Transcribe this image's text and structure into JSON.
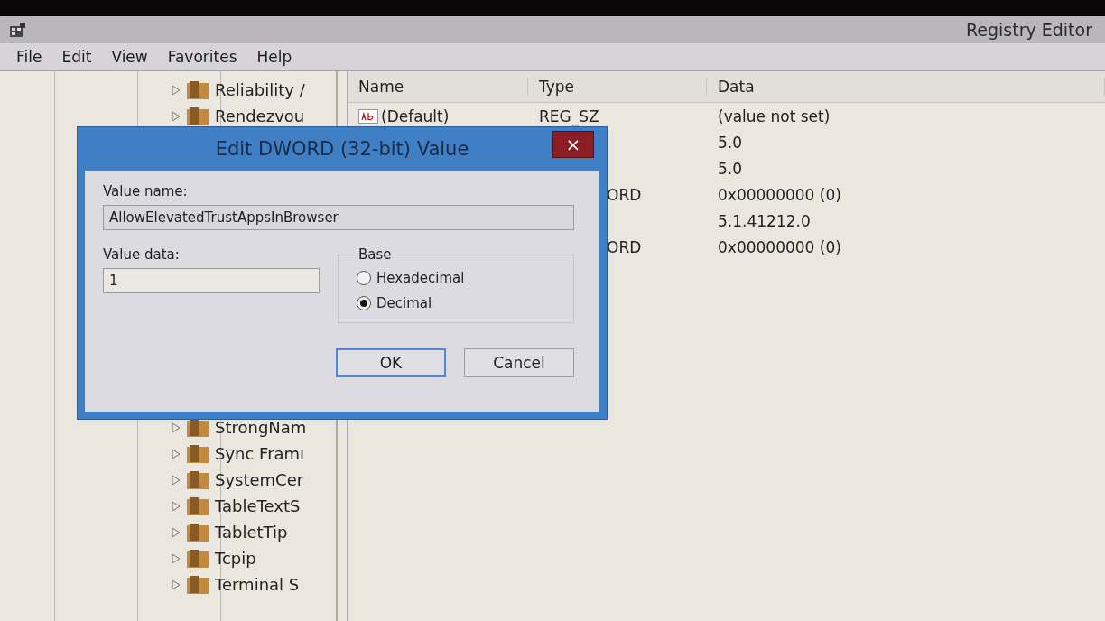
{
  "window": {
    "title": "Registry Editor"
  },
  "menu": [
    "File",
    "Edit",
    "View",
    "Favorites",
    "Help"
  ],
  "tree": {
    "top": [
      {
        "label": "Reliability /"
      },
      {
        "label": "Rendezvou"
      }
    ],
    "bottom": [
      {
        "label": "StrongNam"
      },
      {
        "label": "Sync Framı"
      },
      {
        "label": "SystemCer"
      },
      {
        "label": "TableTextS"
      },
      {
        "label": "TabletTip"
      },
      {
        "label": "Tcpip"
      },
      {
        "label": "Terminal S"
      }
    ]
  },
  "table": {
    "columns": [
      "Name",
      "Type",
      "Data"
    ],
    "rows": [
      {
        "name": "(Default)",
        "type": "REG_SZ",
        "data": "(value not set)"
      },
      {
        "data": "5.0"
      },
      {
        "data": "5.0"
      },
      {
        "type": "ORD",
        "type_clipped": true,
        "data": "0x00000000 (0)"
      },
      {
        "data": "5.1.41212.0"
      },
      {
        "type": "ORD",
        "type_clipped": true,
        "data": "0x00000000 (0)"
      }
    ]
  },
  "dialog": {
    "title": "Edit DWORD (32-bit) Value",
    "close": "×",
    "value_name_label": "Value name:",
    "value_name": "AllowElevatedTrustAppsInBrowser",
    "value_data_label": "Value data:",
    "value_data": "1",
    "base": {
      "label": "Base",
      "options": [
        {
          "label": "Hexadecimal",
          "selected": false
        },
        {
          "label": "Decimal",
          "selected": true
        }
      ]
    },
    "buttons": [
      {
        "label": "OK",
        "default": true
      },
      {
        "label": "Cancel",
        "default": false
      }
    ]
  }
}
